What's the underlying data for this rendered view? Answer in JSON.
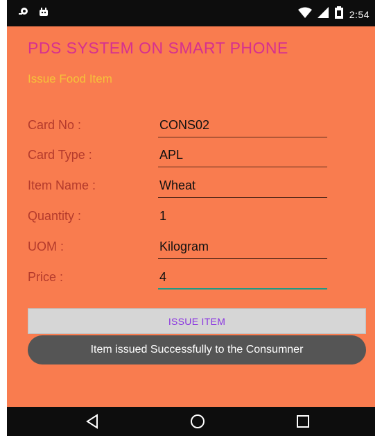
{
  "status_bar": {
    "time": "2:54",
    "left_icons": [
      "app-notification-icon",
      "android-notification-icon"
    ],
    "right_icons": [
      "wifi-icon",
      "cell-signal-icon",
      "battery-icon"
    ]
  },
  "header": {
    "app_title": "PDS SYSTEM ON SMART PHONE",
    "subtitle": "Issue Food Item"
  },
  "form": {
    "fields": [
      {
        "label": "Card No :",
        "value": "CONS02"
      },
      {
        "label": "Card Type :",
        "value": "APL"
      },
      {
        "label": "Item Name :",
        "value": "Wheat"
      },
      {
        "label": "Quantity :",
        "value": "1"
      },
      {
        "label": "UOM :",
        "value": "Kilogram"
      },
      {
        "label": "Price :",
        "value": "4"
      }
    ]
  },
  "actions": {
    "issue_button_label": "ISSUE ITEM"
  },
  "toast": {
    "message": "Item issued Successfully to the Consumner"
  },
  "nav_bar": {
    "buttons": [
      "back-icon",
      "home-icon",
      "recents-icon"
    ]
  },
  "colors": {
    "background": "#f97c4f",
    "title": "#d6308f",
    "subtitle": "#f6c23a",
    "label": "#b43a2c",
    "button_text": "#8a35e0",
    "focus_underline": "#1f9a86"
  }
}
